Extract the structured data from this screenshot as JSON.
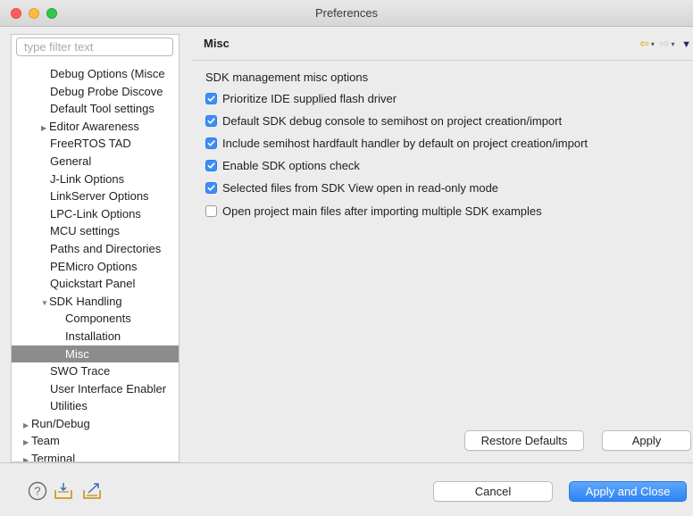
{
  "window": {
    "title": "Preferences"
  },
  "filter": {
    "placeholder": "type filter text"
  },
  "tree": [
    {
      "label": "Debug Options (Misce",
      "level": 1,
      "arrow": ""
    },
    {
      "label": "Debug Probe Discove",
      "level": 1,
      "arrow": ""
    },
    {
      "label": "Default Tool settings",
      "level": 1,
      "arrow": ""
    },
    {
      "label": "Editor Awareness",
      "level": 1,
      "arrow": "▶"
    },
    {
      "label": "FreeRTOS TAD",
      "level": 1,
      "arrow": ""
    },
    {
      "label": "General",
      "level": 1,
      "arrow": ""
    },
    {
      "label": "J-Link Options",
      "level": 1,
      "arrow": ""
    },
    {
      "label": "LinkServer Options",
      "level": 1,
      "arrow": ""
    },
    {
      "label": "LPC-Link Options",
      "level": 1,
      "arrow": ""
    },
    {
      "label": "MCU settings",
      "level": 1,
      "arrow": ""
    },
    {
      "label": "Paths and Directories",
      "level": 1,
      "arrow": ""
    },
    {
      "label": "PEMicro Options",
      "level": 1,
      "arrow": ""
    },
    {
      "label": "Quickstart Panel",
      "level": 1,
      "arrow": ""
    },
    {
      "label": "SDK Handling",
      "level": 1,
      "arrow": "▼"
    },
    {
      "label": "Components",
      "level": 2,
      "arrow": ""
    },
    {
      "label": "Installation",
      "level": 2,
      "arrow": ""
    },
    {
      "label": "Misc",
      "level": 2,
      "arrow": "",
      "selected": true
    },
    {
      "label": "SWO Trace",
      "level": 1,
      "arrow": ""
    },
    {
      "label": "User Interface Enabler",
      "level": 1,
      "arrow": ""
    },
    {
      "label": "Utilities",
      "level": 1,
      "arrow": ""
    },
    {
      "label": "Run/Debug",
      "level": 0,
      "arrow": "▶"
    },
    {
      "label": "Team",
      "level": 0,
      "arrow": "▶"
    },
    {
      "label": "Terminal",
      "level": 0,
      "arrow": "▶"
    }
  ],
  "page": {
    "title": "Misc",
    "section_label": "SDK management misc options",
    "options": [
      {
        "label": "Prioritize IDE supplied flash driver",
        "checked": true
      },
      {
        "label": "Default SDK debug console to semihost on project creation/import",
        "checked": true
      },
      {
        "label": "Include semihost hardfault handler by default on project creation/import",
        "checked": true
      },
      {
        "label": "Enable SDK options check",
        "checked": true
      },
      {
        "label": "Selected files from SDK View open in read-only mode",
        "checked": true
      },
      {
        "label": "Open project main files after importing multiple SDK examples",
        "checked": false
      }
    ],
    "restore_defaults_label": "Restore Defaults",
    "apply_label": "Apply"
  },
  "footer": {
    "cancel_label": "Cancel",
    "apply_close_label": "Apply and Close"
  },
  "icons": {
    "help": "help-icon",
    "import": "import-icon",
    "export": "export-icon",
    "back": "back-arrow-icon",
    "forward": "forward-arrow-icon",
    "view_menu": "view-menu-icon"
  },
  "colors": {
    "accent": "#3d8ef5",
    "selection": "#8c8c8c",
    "back_arrow": "#e8a800"
  }
}
